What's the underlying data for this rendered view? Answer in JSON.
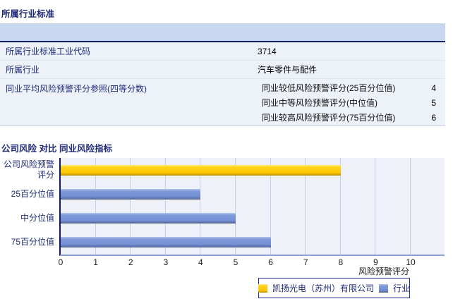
{
  "sections": {
    "industry_standard": {
      "title": "所属行业标准"
    }
  },
  "table": {
    "rows": [
      {
        "label": "所属行业标准工业代码",
        "value": "3714"
      },
      {
        "label": "所属行业",
        "value": "汽车零件与配件"
      }
    ],
    "group_row": {
      "label": "同业平均风险预警评分参照(四等分数)",
      "items": [
        {
          "label": "同业较低风险预警评分(25百分位值)",
          "value": "4"
        },
        {
          "label": "同业中等风险预警评分(中位值)",
          "value": "5"
        },
        {
          "label": "同业较高风险预警评分(75百分位值)",
          "value": "6"
        }
      ]
    }
  },
  "chart_data": {
    "type": "bar",
    "orientation": "horizontal",
    "title": "公司风险 对比 同业风险指标",
    "categories": [
      "公司风险预警评分",
      "25百分位值",
      "中分位值",
      "75百分位值"
    ],
    "category_display": [
      "公司风险预警\n评分",
      "25百分位值",
      "中分位值",
      "75百分位值"
    ],
    "series": [
      {
        "name": "凯扬光电（苏州）有限公司",
        "color": "#ffcc00",
        "values": [
          8,
          null,
          null,
          null
        ]
      },
      {
        "name": "行业",
        "color": "#7590d6",
        "values": [
          null,
          4,
          5,
          6
        ]
      }
    ],
    "xlabel": "风险预警评分",
    "xlim": [
      0,
      10
    ],
    "xticks": [
      0,
      1,
      2,
      3,
      4,
      5,
      6,
      7,
      8,
      9,
      10
    ],
    "grid": true,
    "legend_position": "bottom"
  },
  "colors": {
    "accent_navy": "#1e2a78",
    "table_header_fill": "#c6d7ef",
    "row_fill": "#edf2f9",
    "plot_background": "#eef1f8",
    "gridline": "#c6d0ea",
    "bar_company": "#ffcc00",
    "bar_industry": "#7590d6"
  }
}
